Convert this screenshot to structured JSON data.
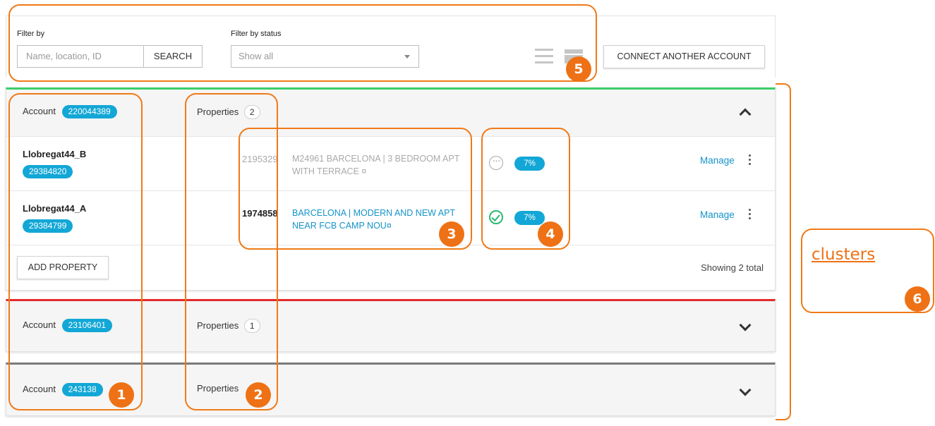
{
  "filters": {
    "filter_by_label": "Filter by",
    "search_placeholder": "Name, location, ID",
    "search_button": "SEARCH",
    "status_label": "Filter by status",
    "status_selected": "Show all",
    "connect_button": "CONNECT ANOTHER ACCOUNT"
  },
  "accounts": [
    {
      "account_label": "Account",
      "account_id": "220044389",
      "properties_label": "Properties",
      "properties_count": "2",
      "accent_color": "#3dcd6a",
      "expanded": true,
      "rows": [
        {
          "name": "Llobregat44_B",
          "listing_id": "29384820",
          "property_number": "2195329",
          "title_line1": "M24961 BARCELONA | 3 BEDROOM APT",
          "title_line2": "WITH TERRACE ¤",
          "status": "pending",
          "percent": "7%",
          "manage": "Manage"
        },
        {
          "name": "Llobregat44_A",
          "listing_id": "29384799",
          "property_number": "1974858",
          "title_line1": "BARCELONA | MODERN AND NEW APT",
          "title_line2": "NEAR FCB CAMP NOU¤",
          "status": "ok",
          "percent": "7%",
          "manage": "Manage"
        }
      ],
      "add_property": "ADD PROPERTY",
      "showing_total": "Showing 2 total"
    },
    {
      "account_label": "Account",
      "account_id": "23106401",
      "properties_label": "Properties",
      "properties_count": "1",
      "accent_color": "#e42b2b",
      "expanded": false
    },
    {
      "account_label": "Account",
      "account_id": "243138",
      "properties_label": "Properties",
      "accent_color": "#7a7a7a",
      "expanded": false
    }
  ],
  "annotations": {
    "labels": [
      "1",
      "2",
      "3",
      "4",
      "5",
      "6"
    ],
    "clusters_text": "clusters",
    "color": "#ee7115"
  }
}
